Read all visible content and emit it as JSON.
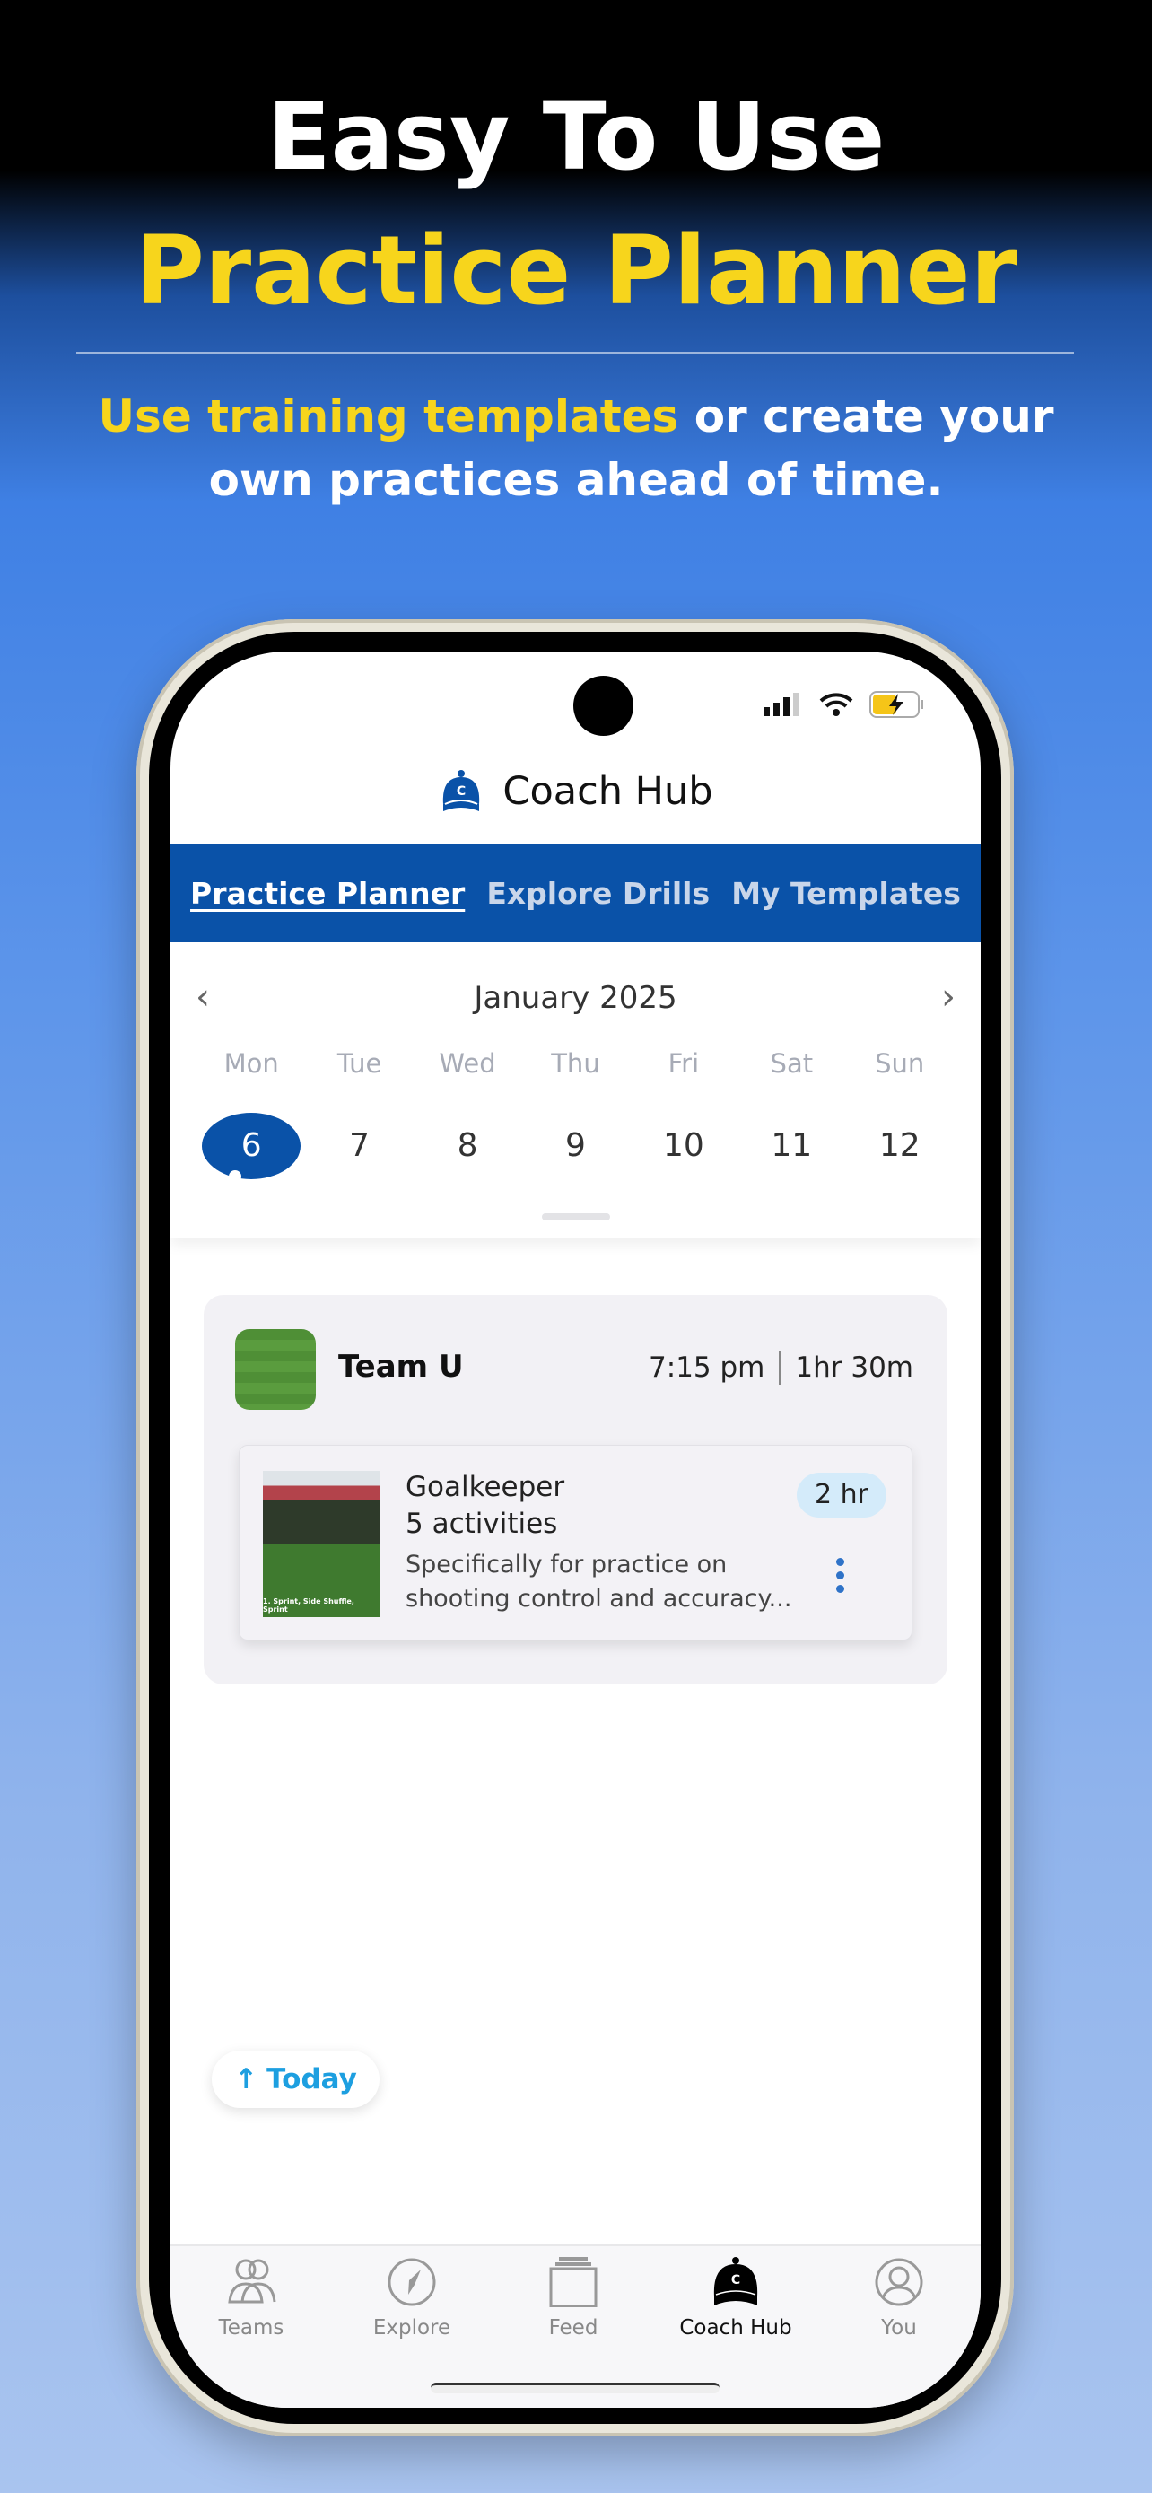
{
  "hero": {
    "line1": "Easy To Use",
    "line2": "Practice Planner",
    "subtitle_highlight": "Use  training templates",
    "subtitle_rest": " or create your",
    "subtitle_line2": "own practices ahead of time."
  },
  "colors": {
    "accent_yellow": "#f7d51c",
    "brand_blue": "#0a52a8",
    "today_blue": "#1d9fe0",
    "pill_bg": "#d4ebfa"
  },
  "app": {
    "title": "Coach Hub",
    "logo_icon": "cap-c-icon"
  },
  "tabs": [
    {
      "label": "Practice Planner",
      "active": true
    },
    {
      "label": "Explore Drills",
      "active": false
    },
    {
      "label": "My Templates",
      "active": false
    }
  ],
  "calendar": {
    "month": "January 2025",
    "day_names": [
      "Mon",
      "Tue",
      "Wed",
      "Thu",
      "Fri",
      "Sat",
      "Sun"
    ],
    "dates": [
      "6",
      "7",
      "8",
      "9",
      "10",
      "11",
      "12"
    ],
    "selected": "6"
  },
  "session": {
    "team": "Team U",
    "time": "7:15 pm",
    "duration": "1hr 30m",
    "practice": {
      "title": "Goalkeeper",
      "activities": "5 activities",
      "description_line1": "Specifically for practice on",
      "description_line2": "shooting control and accuracy...",
      "badge": "2 hr",
      "thumb_caption": "1. Sprint, Side Shuffle, Sprint"
    }
  },
  "today_button": "Today",
  "bottom_nav": [
    {
      "label": "Teams",
      "icon": "teams-icon"
    },
    {
      "label": "Explore",
      "icon": "compass-icon"
    },
    {
      "label": "Feed",
      "icon": "feed-icon"
    },
    {
      "label": "Coach Hub",
      "icon": "coach-cap-icon",
      "active": true
    },
    {
      "label": "You",
      "icon": "profile-icon"
    }
  ]
}
